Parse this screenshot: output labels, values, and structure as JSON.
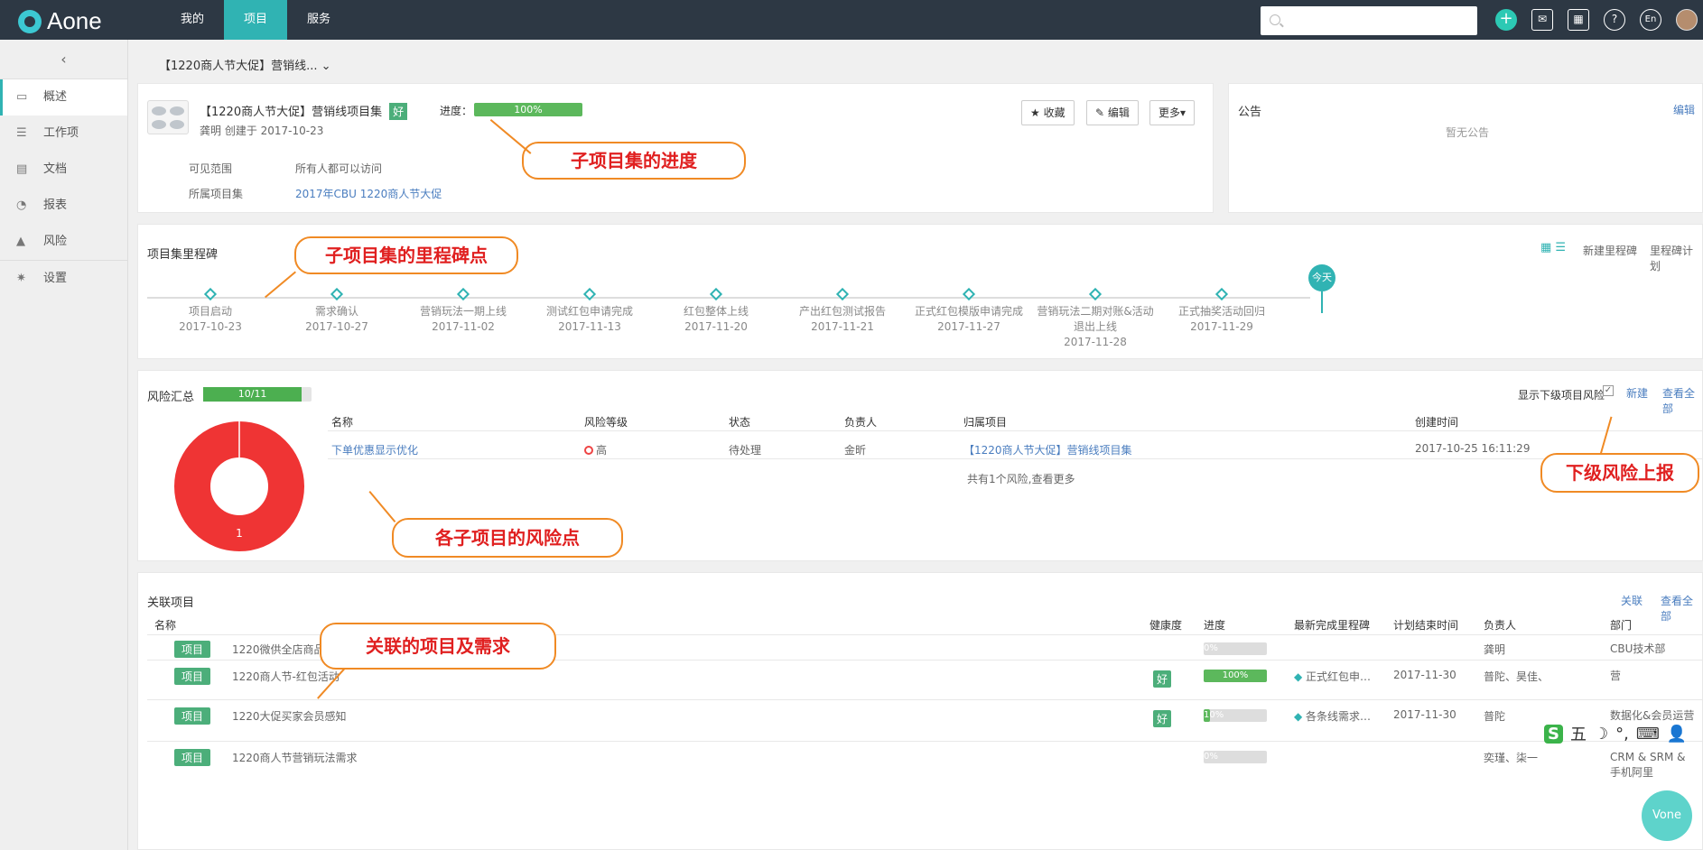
{
  "topbar": {
    "logo": "Aone",
    "nav": [
      {
        "label": "我的"
      },
      {
        "label": "项目"
      },
      {
        "label": "服务"
      }
    ],
    "search_placeholder": "",
    "icons": [
      {
        "name": "plus-icon",
        "glyph": "+"
      },
      {
        "name": "inbox-icon",
        "glyph": "✉"
      },
      {
        "name": "qrcode-icon",
        "glyph": "▦"
      },
      {
        "name": "help-icon",
        "glyph": "?"
      },
      {
        "name": "language-icon",
        "glyph": "En"
      }
    ]
  },
  "sidebar": {
    "collapse": "‹",
    "items": [
      {
        "label": "概述",
        "icon": "monitor-icon",
        "glyph": "▭"
      },
      {
        "label": "工作项",
        "icon": "workitem-icon",
        "glyph": "☰"
      },
      {
        "label": "文档",
        "icon": "document-icon",
        "glyph": "▤"
      },
      {
        "label": "报表",
        "icon": "chart-pie-icon",
        "glyph": "◔"
      },
      {
        "label": "风险",
        "icon": "warning-icon",
        "glyph": "▲"
      },
      {
        "label": "设置",
        "icon": "gear-icon",
        "glyph": "✷"
      }
    ]
  },
  "breadcrumb": "【1220商人节大促】营销线... ⌄",
  "project": {
    "title": "【1220商人节大促】营销线项目集",
    "health": "好",
    "progress_label": "进度：",
    "progress_text": "100%",
    "progress_value": 1.0,
    "meta": "龚明 创建于 2017-10-23",
    "visibility_label": "可见范围",
    "visibility_value": "所有人都可以访问",
    "parent_label": "所属项目集",
    "parent_value": "2017年CBU 1220商人节大促",
    "btn_fav": "★ 收藏",
    "btn_edit": "✎ 编辑",
    "btn_more": "更多▾"
  },
  "notice": {
    "title": "公告",
    "edit": "编辑",
    "empty": "暂无公告"
  },
  "annotations": {
    "progress": "子项目集的进度",
    "milestone": "子项目集的里程碑点",
    "risk_up": "下级风险上报",
    "risk_points": "各子项目的风险点",
    "related": "关联的项目及需求"
  },
  "milestones": {
    "title": "项目集里程碑",
    "new": "新建里程碑",
    "plan": "里程碑计划",
    "today": "今天",
    "items": [
      {
        "name": "项目启动",
        "date": "2017-10-23"
      },
      {
        "name": "需求确认",
        "date": "2017-10-27"
      },
      {
        "name": "营销玩法一期上线",
        "date": "2017-11-02"
      },
      {
        "name": "测试红包申请完成",
        "date": "2017-11-13"
      },
      {
        "name": "红包整体上线",
        "date": "2017-11-20"
      },
      {
        "name": "产出红包测试报告",
        "date": "2017-11-21"
      },
      {
        "name": "正式红包模版申请完成",
        "date": "2017-11-27"
      },
      {
        "name": "营销玩法二期对账&活动退出上线",
        "date": "2017-11-28"
      },
      {
        "name": "正式抽奖活动回归",
        "date": "2017-11-29"
      }
    ]
  },
  "risk": {
    "title": "风险汇总",
    "progress_text": "10/11",
    "progress_value": 0.91,
    "show_sub": "显示下级项目风险",
    "new": "新建",
    "view_all": "查看全部",
    "headers": [
      "名称",
      "风险等级",
      "状态",
      "负责人",
      "归属项目",
      "创建时间"
    ],
    "rows": [
      {
        "name": "下单优惠显示优化",
        "level": "高",
        "status": "待处理",
        "owner": "金昕",
        "project": "【1220商人节大促】营销线项目集",
        "created": "2017-10-25 16:11:29"
      }
    ],
    "footer": "共有1个风险,查看更多",
    "pie_label": "1",
    "pie_value": 1,
    "pie_color": "#ef3434"
  },
  "related": {
    "title": "关联项目",
    "link": "关联",
    "view_all": "查看全部",
    "headers": [
      "名称",
      "健康度",
      "进度",
      "最新完成里程碑",
      "计划结束时间",
      "负责人",
      "部门"
    ],
    "rows": [
      {
        "tag": "项目",
        "name": "1220微供全店商品包邮需求变更",
        "health": "",
        "progress": 0.0,
        "progress_text": "0%",
        "milestone": "",
        "end": "",
        "owner": "龚明",
        "dept": "CBU技术部"
      },
      {
        "tag": "项目",
        "name": "1220商人节-红包活动",
        "health": "好",
        "progress": 1.0,
        "progress_text": "100%",
        "milestone": "正式红包申…",
        "end": "2017-11-30",
        "owner": "普陀、昊佳、",
        "dept": "营"
      },
      {
        "tag": "项目",
        "name": "1220大促买家会员感知",
        "health": "好",
        "progress": 0.1,
        "progress_text": "10%",
        "milestone": "各条线需求…",
        "end": "2017-11-30",
        "owner": "普陀",
        "dept": "数据化&会员运营"
      },
      {
        "tag": "项目",
        "name": "1220商人节营销玩法需求",
        "health": "",
        "progress": 0.0,
        "progress_text": "0%",
        "milestone": "",
        "end": "",
        "owner": "奕瑾、柒一",
        "dept": "CRM & SRM & 手机阿里"
      }
    ]
  },
  "floating": {
    "ime": [
      "S",
      "五",
      "☽",
      "°,",
      "⌨",
      "👤"
    ],
    "vone": "Vone"
  }
}
